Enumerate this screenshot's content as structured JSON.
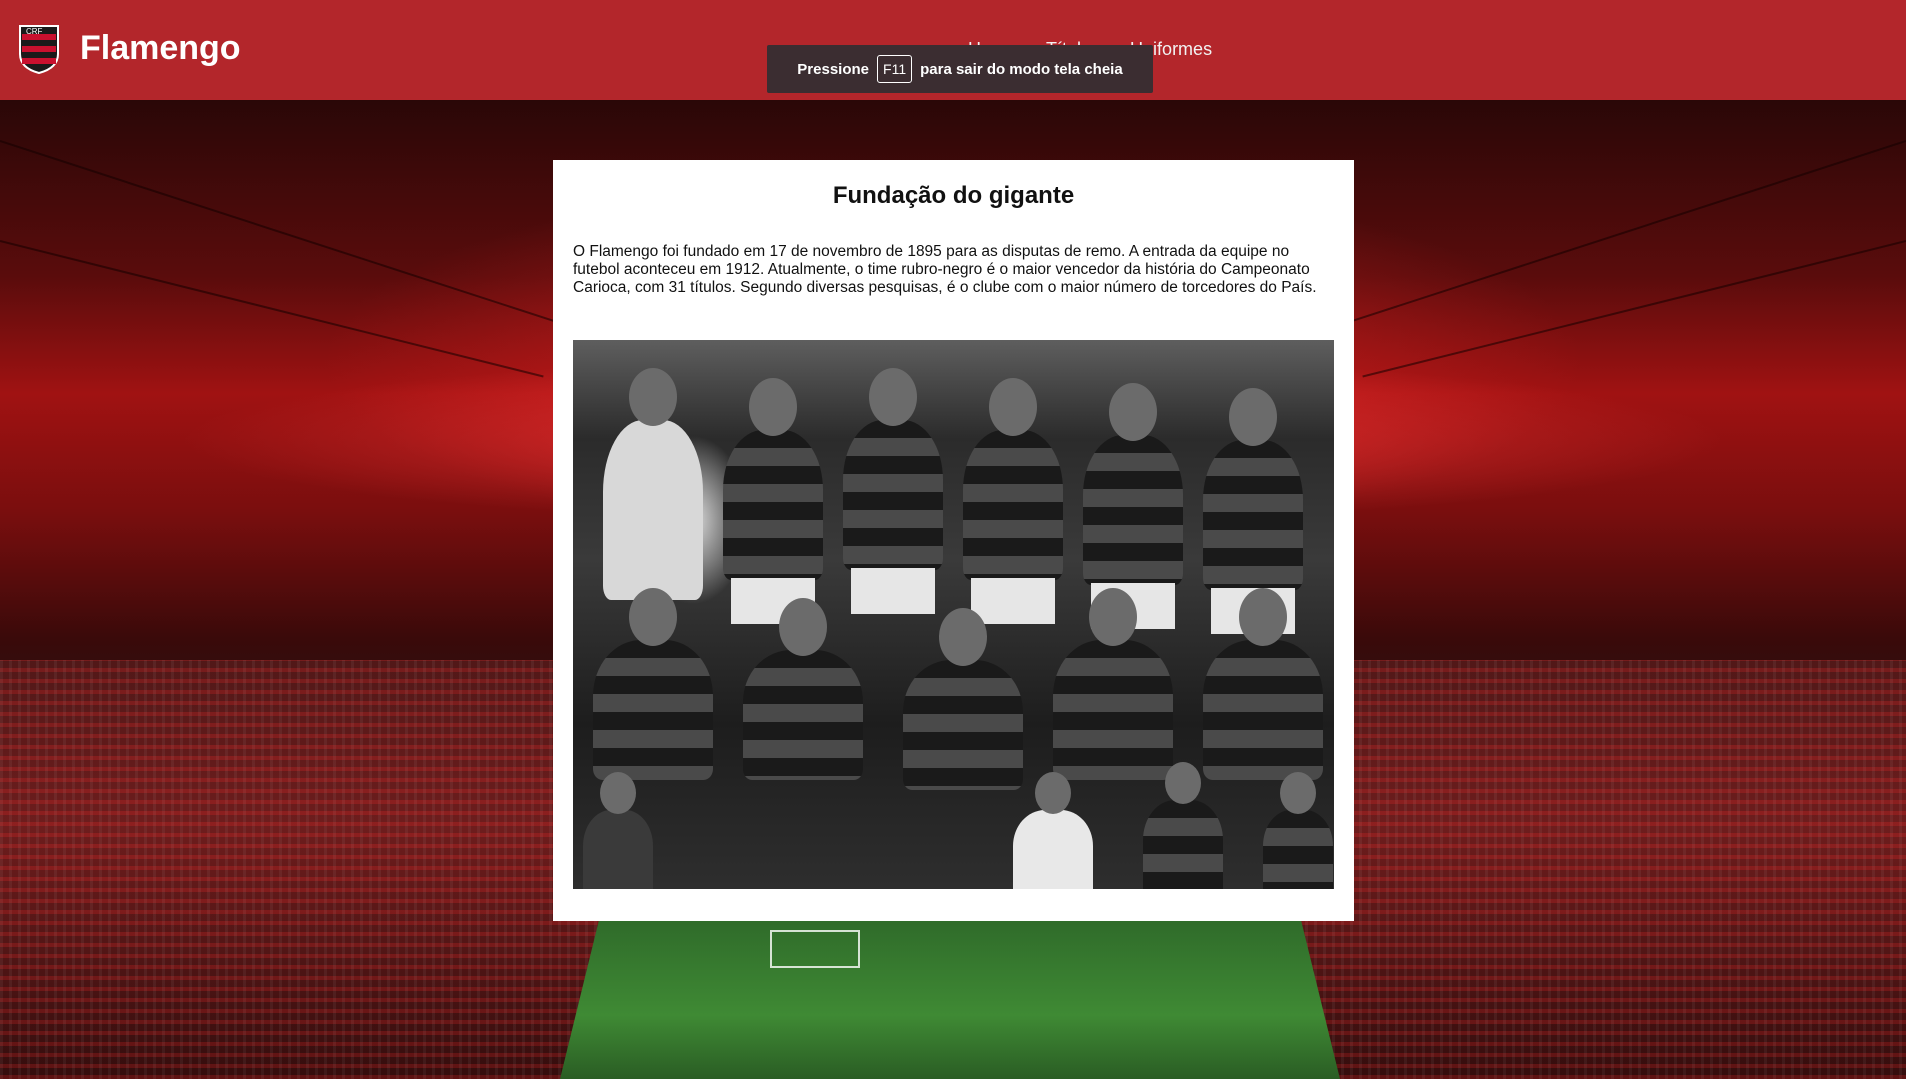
{
  "header": {
    "brand": "Flamengo",
    "nav": [
      "Home",
      "Títulos",
      "Uniformes"
    ]
  },
  "fullscreen_notice": {
    "prefix": "Pressione",
    "key": "F11",
    "suffix": "para sair do modo tela cheia"
  },
  "card": {
    "title": "Fundação do gigante",
    "text": "O Flamengo foi fundado em 17 de novembro de 1895 para as disputas de remo. A entrada da equipe no futebol aconteceu em 1912. Atualmente, o time rubro-negro é o maior vencedor da história do Campeonato Carioca, com 31 títulos. Segundo diversas pesquisas, é o clube com o maior número de torcedores do País."
  },
  "colors": {
    "header_bg": "#b3262b",
    "accent_red": "#c8102e",
    "black": "#111111"
  },
  "icons": {
    "logo": "flamengo-crest-icon"
  }
}
